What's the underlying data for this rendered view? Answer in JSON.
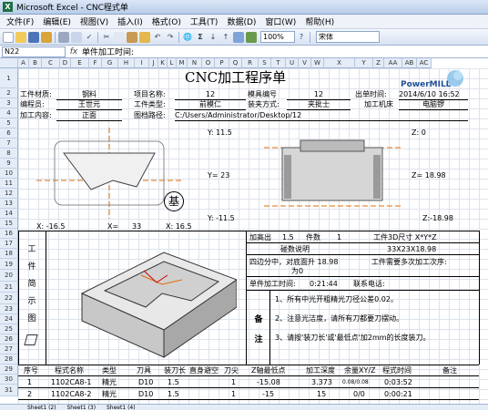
{
  "window": {
    "title": "Microsoft Excel - CNC程式单"
  },
  "menu": [
    "文件(F)",
    "编辑(E)",
    "视图(V)",
    "插入(I)",
    "格式(O)",
    "工具(T)",
    "数据(D)",
    "窗口(W)",
    "帮助(H)"
  ],
  "toolbar": {
    "zoom": "100%",
    "font": "宋体"
  },
  "formula": {
    "name_box": "N22",
    "fx": "fx",
    "value": "单件加工时间:"
  },
  "columns": [
    "A",
    "B",
    "C",
    "D",
    "E",
    "F",
    "G",
    "H",
    "I",
    "J",
    "K",
    "L",
    "M",
    "N",
    "O",
    "P",
    "Q",
    "R",
    "S",
    "T",
    "U",
    "V",
    "W",
    "X",
    "Y",
    "Z",
    "AA",
    "AB",
    "AC"
  ],
  "rows": [
    "1",
    "2",
    "3",
    "4",
    "5",
    "6",
    "7",
    "8",
    "9",
    "10",
    "11",
    "12",
    "13",
    "14",
    "15",
    "16",
    "17",
    "18",
    "19",
    "20",
    "21",
    "22",
    "23",
    "24",
    "25",
    "26",
    "27",
    "28",
    "29",
    "30",
    "31",
    "32"
  ],
  "sheet": {
    "title": "CNC加工程序单",
    "logo": "PowerMILL",
    "workpiece_label": "工件材质:",
    "workpiece_value": "钢料",
    "project_label": "项目名称:",
    "project_value": "12",
    "mold_label": "模具编号",
    "mold_value": "12",
    "time_label": "出单时间:",
    "time_value": "2014/6/10 16:52",
    "programmer_label": "编程员:",
    "programmer_value": "王世元",
    "type_label": "工件类型:",
    "type_value": "前模仁",
    "clamp_label": "装夹方式:",
    "clamp_value": "夹批士",
    "machine_label": "加工机床",
    "machine_value": "电脑锣",
    "content_label": "加工内容:",
    "content_value": "正面",
    "path_label": "图档路径:",
    "path_value": "C:/Users/Administrator/Desktop/12",
    "y_top": "Y: 11.5",
    "z_top": "Z: 0",
    "y_mid": "Y= 23",
    "z_mid": "Z= 18.98",
    "y_bot": "Y: -11.5",
    "z_bot": "Z:-18.98",
    "x_neg": "X: -16.5",
    "x_mid": "X=",
    "x_mid_val": "33",
    "x_pos": "X: 16.5",
    "base": "基",
    "side_label": "工件简示图",
    "clearance_label": "加高出",
    "clearance_value": "1.5",
    "count_label": "件数",
    "count_value": "1",
    "size_label": "工件3D尺寸 X*Y*Z",
    "datum_label": "碰数说明",
    "size_value": "33X23X18.98",
    "datum_text_1": "四边分中，对底面升 18.98",
    "datum_text_2": "为0",
    "repeat_label": "工件需要多次加工次序:",
    "unit_time_label": "单件加工时间:",
    "unit_time_value": "0:21:44",
    "phone_label": "联系电话:",
    "note_label": "备注",
    "notes": [
      "1、所有中光开粗精光刀径公差0.02。",
      "2、注意光洁度，请所有刀都要刀摆动。",
      "3、请按'装刀长'或'最低点'加2mm的长度装刀。"
    ],
    "table_headers": [
      "序号",
      "程式名称",
      "类型",
      "刀具",
      "装刀长",
      "直身避空",
      "刀尖",
      "Z轴最低点",
      "加工深度",
      "余量XY/Z",
      "程式时间",
      "备注"
    ],
    "table_rows": [
      [
        "1",
        "1102CA8-1",
        "精光",
        "D10",
        "1.5",
        "",
        "1",
        "-15.08",
        "3.373",
        "0.08/0.08",
        "0:03:52",
        ""
      ],
      [
        "2",
        "1102CA8-2",
        "精光",
        "D10",
        "1.5",
        "",
        "1",
        "-15",
        "15",
        "0/0",
        "0:00:21",
        ""
      ]
    ]
  },
  "sheet_tabs": [
    "Sheet1 (2)",
    "Sheet1 (3)",
    "Sheet1 (4)"
  ]
}
